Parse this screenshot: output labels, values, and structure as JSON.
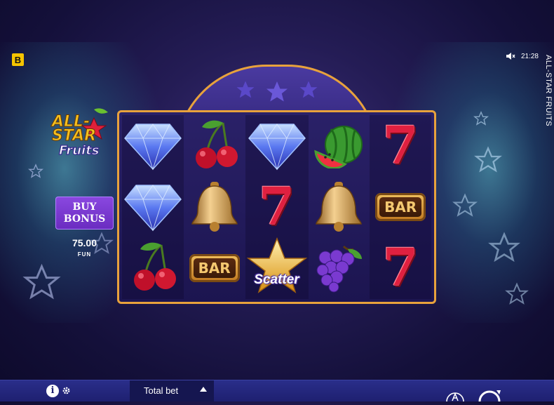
{
  "game": {
    "title_vertical": "ALL-STAR FRUITS",
    "logo": {
      "line1": "ALL-",
      "line2": "STAR",
      "line3": "Fruits"
    },
    "brand_badge": "B"
  },
  "status": {
    "time": "21:28",
    "sound": "muted"
  },
  "buy_bonus": {
    "line1": "BUY",
    "line2": "BONUS",
    "price": "75.00",
    "currency": "FUN"
  },
  "reels": {
    "rows": [
      [
        "diamond",
        "cherry",
        "diamond",
        "watermelon",
        "seven"
      ],
      [
        "diamond",
        "bell",
        "seven",
        "bell",
        "bar"
      ],
      [
        "cherry",
        "bar",
        "scatter",
        "grapes",
        "seven"
      ]
    ],
    "bar_label": "BAR",
    "scatter_label": "Scatter"
  },
  "bottom_bar": {
    "total_bet_label": "Total bet",
    "info_label": "i"
  },
  "colors": {
    "frame": "#e8a23c",
    "accent_purple": "#7a3ad0",
    "bar": "#1e2070"
  }
}
